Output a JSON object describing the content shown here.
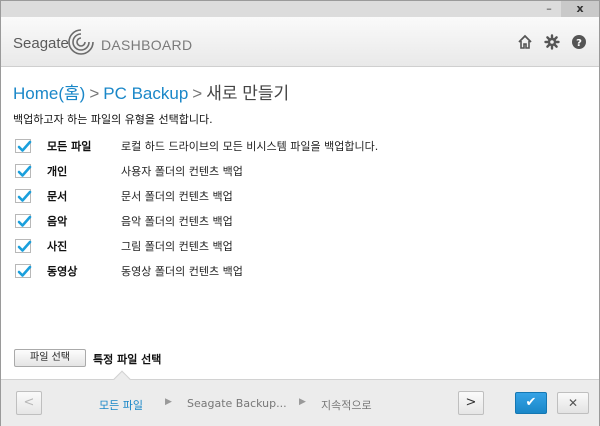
{
  "titlebar": {
    "minimize_glyph": "–",
    "close_glyph": "x"
  },
  "header": {
    "brand": "Seagate",
    "app_name": "DASHBOARD",
    "icons": [
      "home-icon",
      "gear-icon",
      "help-icon"
    ]
  },
  "breadcrumb": {
    "items": [
      "Home(홈)",
      "PC Backup",
      "새로 만들기"
    ],
    "separator": ">"
  },
  "instruction": "백업하고자 하는 파일의 유형을 선택합니다.",
  "options": [
    {
      "label": "모든 파일",
      "description": "로컬 하드 드라이브의 모든 비시스템 파일을 백업합니다.",
      "checked": true
    },
    {
      "label": "개인",
      "description": "사용자 폴더의 컨텐츠 백업",
      "checked": true
    },
    {
      "label": "문서",
      "description": "문서 폴더의 컨텐츠 백업",
      "checked": true
    },
    {
      "label": "음악",
      "description": "음악 폴더의 컨텐츠 백업",
      "checked": true
    },
    {
      "label": "사진",
      "description": "그림 폴더의 컨텐츠 백업",
      "checked": true
    },
    {
      "label": "동영상",
      "description": "동영상 폴더의 컨텐츠 백업",
      "checked": true
    }
  ],
  "file_select": {
    "button_label": "파일 선택",
    "label": "특정 파일 선택"
  },
  "wizard": {
    "steps": [
      "모든 파일",
      "Seagate Backup...",
      "지속적으로"
    ],
    "active_step": 0,
    "prev_glyph": "<",
    "next_glyph": ">",
    "ok_glyph": "✔",
    "cancel_glyph": "✕"
  },
  "colors": {
    "accent": "#1a87c8",
    "check": "#1a9fdc"
  }
}
